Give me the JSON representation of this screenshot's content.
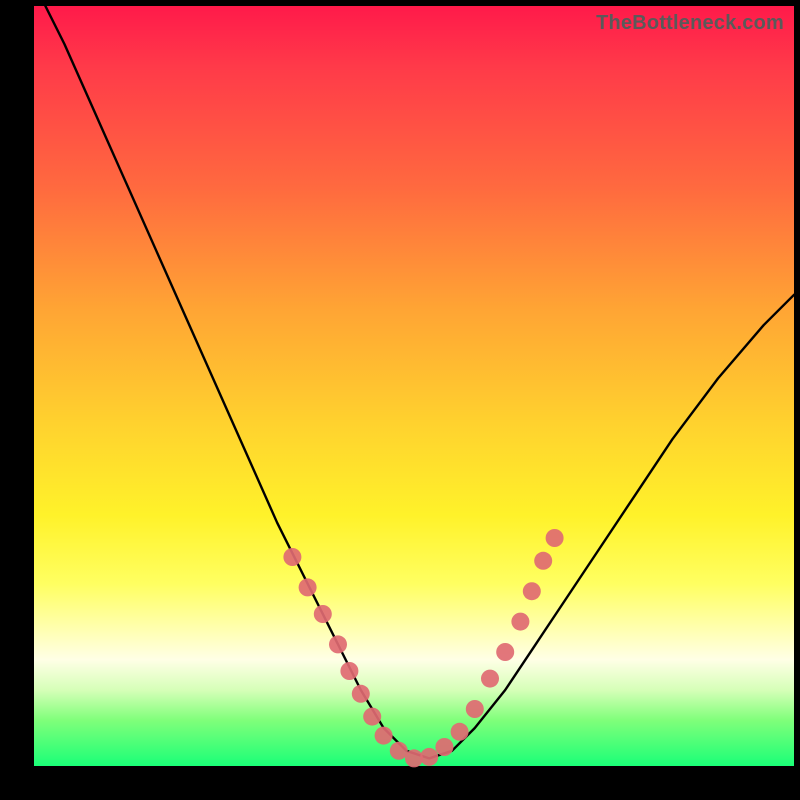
{
  "watermark": "TheBottleneck.com",
  "chart_data": {
    "type": "line",
    "title": "",
    "xlabel": "",
    "ylabel": "",
    "xlim": [
      0,
      100
    ],
    "ylim": [
      0,
      100
    ],
    "series": [
      {
        "name": "bottleneck-curve",
        "x": [
          0,
          4,
          8,
          12,
          16,
          20,
          24,
          28,
          32,
          36,
          40,
          43,
          46,
          49,
          52,
          55,
          58,
          62,
          66,
          72,
          78,
          84,
          90,
          96,
          100
        ],
        "values": [
          103,
          95,
          86,
          77,
          68,
          59,
          50,
          41,
          32,
          24,
          16,
          10,
          5,
          2,
          1,
          2,
          5,
          10,
          16,
          25,
          34,
          43,
          51,
          58,
          62
        ]
      }
    ],
    "markers": {
      "name": "highlight-dots",
      "color": "#e06a72",
      "points": [
        {
          "x": 34.0,
          "y": 27.5
        },
        {
          "x": 36.0,
          "y": 23.5
        },
        {
          "x": 38.0,
          "y": 20.0
        },
        {
          "x": 40.0,
          "y": 16.0
        },
        {
          "x": 41.5,
          "y": 12.5
        },
        {
          "x": 43.0,
          "y": 9.5
        },
        {
          "x": 44.5,
          "y": 6.5
        },
        {
          "x": 46.0,
          "y": 4.0
        },
        {
          "x": 48.0,
          "y": 2.0
        },
        {
          "x": 50.0,
          "y": 1.0
        },
        {
          "x": 52.0,
          "y": 1.2
        },
        {
          "x": 54.0,
          "y": 2.5
        },
        {
          "x": 56.0,
          "y": 4.5
        },
        {
          "x": 58.0,
          "y": 7.5
        },
        {
          "x": 60.0,
          "y": 11.5
        },
        {
          "x": 62.0,
          "y": 15.0
        },
        {
          "x": 64.0,
          "y": 19.0
        },
        {
          "x": 65.5,
          "y": 23.0
        },
        {
          "x": 67.0,
          "y": 27.0
        },
        {
          "x": 68.5,
          "y": 30.0
        }
      ]
    },
    "gradient_stops": [
      {
        "pct": 0,
        "color": "#ff1a4a"
      },
      {
        "pct": 24,
        "color": "#ff6a3f"
      },
      {
        "pct": 55,
        "color": "#ffd22e"
      },
      {
        "pct": 82,
        "color": "#ffffb0"
      },
      {
        "pct": 100,
        "color": "#1aff77"
      }
    ]
  }
}
